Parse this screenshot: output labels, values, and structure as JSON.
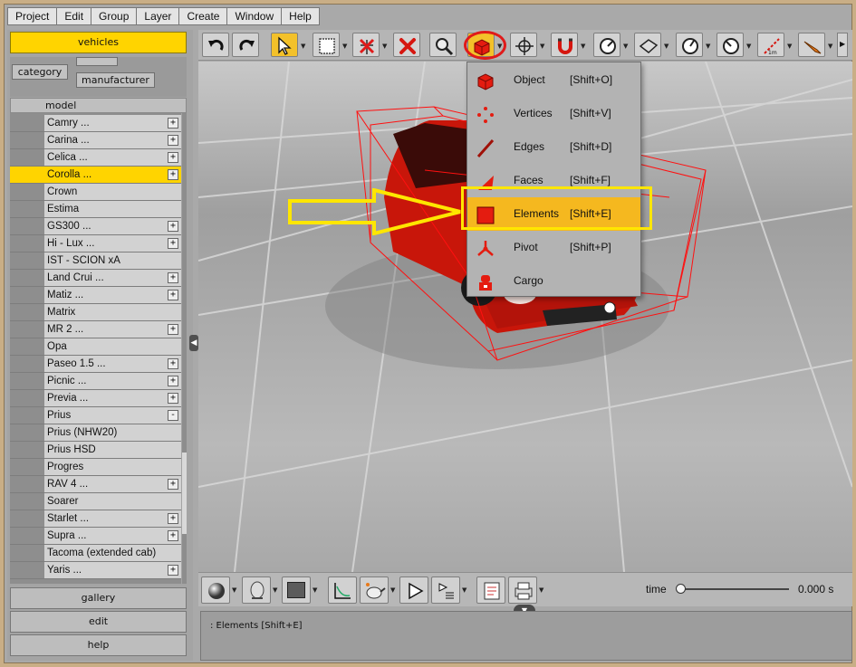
{
  "menubar": [
    "Project",
    "Edit",
    "Group",
    "Layer",
    "Create",
    "Window",
    "Help"
  ],
  "left_panel": {
    "vehicles_label": "vehicles",
    "tab_category": "category",
    "tab_manufacturer": "manufacturer",
    "column_header": "model",
    "rows": [
      {
        "label": "Camry ...",
        "expand": "+"
      },
      {
        "label": "Carina ...",
        "expand": "+"
      },
      {
        "label": "Celica ...",
        "expand": "+"
      },
      {
        "label": "Corolla ...",
        "expand": "+",
        "selected": true
      },
      {
        "label": "Crown",
        "expand": ""
      },
      {
        "label": "Estima",
        "expand": ""
      },
      {
        "label": "GS300 ...",
        "expand": "+"
      },
      {
        "label": "Hi - Lux ...",
        "expand": "+"
      },
      {
        "label": "IST - SCION xA",
        "expand": ""
      },
      {
        "label": "Land Crui ...",
        "expand": "+"
      },
      {
        "label": "Matiz ...",
        "expand": "+"
      },
      {
        "label": "Matrix",
        "expand": ""
      },
      {
        "label": "MR 2 ...",
        "expand": "+"
      },
      {
        "label": "Opa",
        "expand": ""
      },
      {
        "label": "Paseo 1.5 ...",
        "expand": "+"
      },
      {
        "label": "Picnic ...",
        "expand": "+"
      },
      {
        "label": "Previa ...",
        "expand": "+"
      },
      {
        "label": "Prius",
        "expand": "-"
      },
      {
        "label": "Prius (NHW20)",
        "expand": ""
      },
      {
        "label": "Prius HSD",
        "expand": ""
      },
      {
        "label": "Progres",
        "expand": ""
      },
      {
        "label": "RAV 4 ...",
        "expand": "+"
      },
      {
        "label": "Soarer",
        "expand": ""
      },
      {
        "label": "Starlet ...",
        "expand": "+"
      },
      {
        "label": "Supra ...",
        "expand": "+"
      },
      {
        "label": "Tacoma (extended cab)",
        "expand": ""
      },
      {
        "label": "Yaris ...",
        "expand": "+"
      }
    ],
    "gallery_label": "gallery",
    "edit_label": "edit",
    "help_label": "help"
  },
  "dropdown": {
    "items": [
      {
        "label": "Object",
        "shortcut": "[Shift+O]",
        "icon": "object-cube-icon"
      },
      {
        "label": "Vertices",
        "shortcut": "[Shift+V]",
        "icon": "vertices-icon"
      },
      {
        "label": "Edges",
        "shortcut": "[Shift+D]",
        "icon": "edges-icon"
      },
      {
        "label": "Faces",
        "shortcut": "[Shift+F]",
        "icon": "faces-icon"
      },
      {
        "label": "Elements",
        "shortcut": "[Shift+E]",
        "icon": "elements-icon",
        "highlighted": true
      },
      {
        "label": "Pivot",
        "shortcut": "[Shift+P]",
        "icon": "pivot-icon"
      },
      {
        "label": "Cargo",
        "shortcut": "",
        "icon": "cargo-icon"
      }
    ]
  },
  "timeline": {
    "label": "time",
    "value": "0.000 s",
    "position": 0
  },
  "status_text": ": Elements [Shift+E]",
  "colors": {
    "selection_yellow": "#ffd400",
    "highlight_orange": "#f5b81f",
    "annotation_red": "#e01a1a",
    "annotation_yellow": "#ffe600",
    "car_red": "#d41a0a"
  }
}
